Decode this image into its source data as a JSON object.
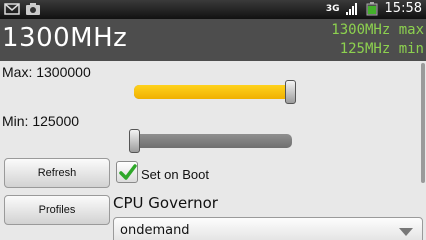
{
  "header": {
    "current_freq": "1300MHz",
    "max_label": "1300MHz max",
    "min_label": "125MHz min"
  },
  "max_slider": {
    "label": "Max: 1300000",
    "level": 1.0
  },
  "min_slider": {
    "label": "Min: 125000",
    "level": 0.0
  },
  "buttons": {
    "refresh": "Refresh",
    "profiles": "Profiles"
  },
  "set_on_boot": {
    "label": "Set on Boot",
    "checked": true
  },
  "governor": {
    "title": "CPU Governor",
    "value": "ondemand"
  },
  "colors": {
    "accent_fill": "#f8c20c",
    "freq_text": "#8dd14f",
    "header_bg": "#4d4d4d"
  },
  "statusbar": {
    "icons": [
      "gmail-icon",
      "camera-icon",
      "3g-icon",
      "signal-icon",
      "battery-icon"
    ],
    "network": "3G",
    "time": "15:58"
  }
}
